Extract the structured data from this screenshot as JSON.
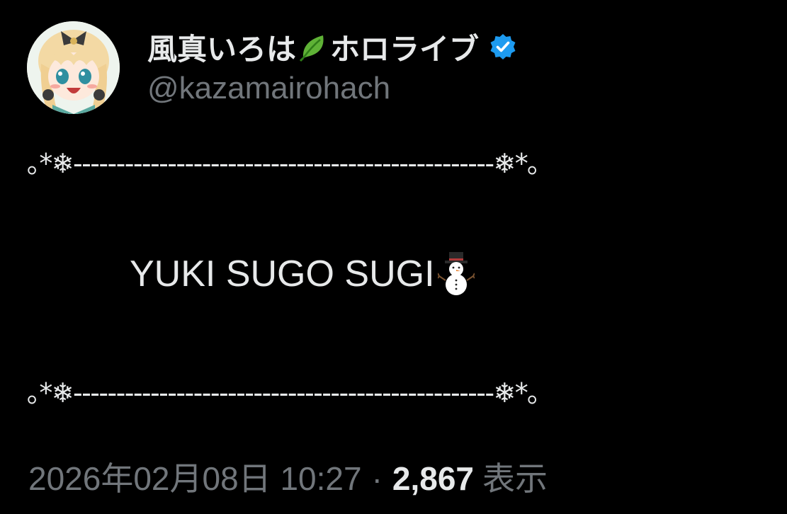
{
  "tweet": {
    "author": {
      "display_name": "風真いろは",
      "display_name_suffix": "ホロライブ",
      "name_emoji_icon": "leaf-icon",
      "verified_icon": "verified-badge-icon",
      "handle": "@kazamairohach"
    },
    "decorations": {
      "top": "｡*❄︎-------------------------------------------------❄︎*｡",
      "bottom": "｡*❄︎-------------------------------------------------❄︎*｡"
    },
    "body": {
      "text": "YUKI SUGO SUGI",
      "emoji_icon": "snowman-icon"
    },
    "meta": {
      "timestamp": "2026年02月08日 10:27",
      "separator": "·",
      "views_count": "2,867",
      "views_label": "表示"
    }
  },
  "colors": {
    "background": "#000000",
    "primary_text": "#e7e9ea",
    "secondary_text": "#71767b",
    "verified_blue": "#1d9bf0"
  }
}
